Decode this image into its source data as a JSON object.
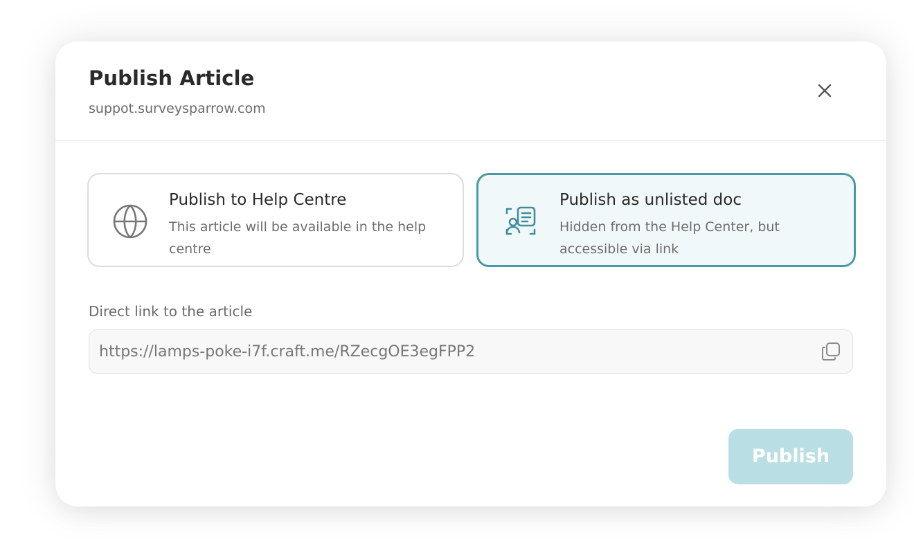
{
  "modal": {
    "title": "Publish Article",
    "subtitle": "suppot.surveysparrow.com",
    "close_icon": "close-icon"
  },
  "options": [
    {
      "id": "help-centre",
      "title": "Publish to Help Centre",
      "description": "This article will be available in the help centre",
      "icon": "globe-icon",
      "selected": false
    },
    {
      "id": "unlisted",
      "title": "Publish as unlisted doc",
      "description": "Hidden from the Help Center, but accessible via link",
      "icon": "id-card-icon",
      "selected": true
    }
  ],
  "link": {
    "label": "Direct link to the article",
    "value": "https://lamps-poke-i7f.craft.me/RZecgOE3egFPP2",
    "copy_icon": "copy-icon"
  },
  "footer": {
    "publish_label": "Publish"
  },
  "colors": {
    "accent": "#4a9aa5",
    "selected_bg": "#f1f8f9",
    "publish_disabled_bg": "#b9dfe4",
    "title_text": "#2a2a2a",
    "muted_text": "#6a6a6a"
  }
}
